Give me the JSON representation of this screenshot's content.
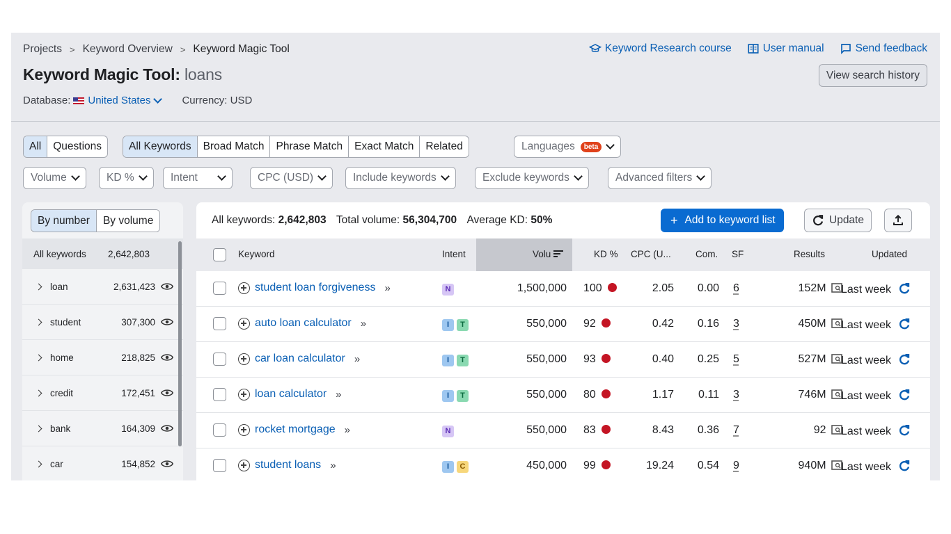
{
  "breadcrumbs": [
    "Projects",
    "Keyword Overview",
    "Keyword Magic Tool"
  ],
  "top_links": {
    "course": "Keyword Research course",
    "manual": "User manual",
    "feedback": "Send feedback"
  },
  "title": {
    "tool": "Keyword Magic Tool:",
    "query": "loans"
  },
  "view_history": "View search history",
  "database": {
    "label": "Database:",
    "country": "United States",
    "currency": "Currency: USD"
  },
  "tabs_a": [
    "All",
    "Questions"
  ],
  "tabs_b": [
    "All Keywords",
    "Broad Match",
    "Phrase Match",
    "Exact Match",
    "Related"
  ],
  "languages": {
    "label": "Languages",
    "badge": "beta"
  },
  "filters": {
    "volume": "Volume",
    "kd": "KD %",
    "intent": "Intent",
    "cpc": "CPC (USD)",
    "include": "Include keywords",
    "exclude": "Exclude keywords",
    "advanced": "Advanced filters"
  },
  "left_panel": {
    "toggle": [
      "By number",
      "By volume"
    ],
    "all_label": "All keywords",
    "all_count": "2,642,803",
    "groups": [
      {
        "kw": "loan",
        "count": "2,631,423"
      },
      {
        "kw": "student",
        "count": "307,300"
      },
      {
        "kw": "home",
        "count": "218,825"
      },
      {
        "kw": "credit",
        "count": "172,451"
      },
      {
        "kw": "bank",
        "count": "164,309"
      },
      {
        "kw": "car",
        "count": "154,852"
      }
    ]
  },
  "summary": {
    "all_label": "All keywords:",
    "all_value": "2,642,803",
    "vol_label": "Total volume:",
    "vol_value": "56,304,700",
    "kd_label": "Average KD:",
    "kd_value": "50%"
  },
  "buttons": {
    "add": "Add to keyword list",
    "update": "Update"
  },
  "columns": [
    "Keyword",
    "Intent",
    "Volu",
    "KD %",
    "CPC (U...",
    "Com.",
    "SF",
    "Results",
    "Updated"
  ],
  "rows": [
    {
      "kw": "student loan forgiveness",
      "intent": [
        "N"
      ],
      "volume": "1,500,000",
      "kd": "100",
      "cpc": "2.05",
      "com": "0.00",
      "sf": "6",
      "results": "152M",
      "updated": "Last week"
    },
    {
      "kw": "auto loan calculator",
      "intent": [
        "I",
        "T"
      ],
      "volume": "550,000",
      "kd": "92",
      "cpc": "0.42",
      "com": "0.16",
      "sf": "3",
      "results": "450M",
      "updated": "Last week"
    },
    {
      "kw": "car loan calculator",
      "intent": [
        "I",
        "T"
      ],
      "volume": "550,000",
      "kd": "93",
      "cpc": "0.40",
      "com": "0.25",
      "sf": "5",
      "results": "527M",
      "updated": "Last week"
    },
    {
      "kw": "loan calculator",
      "intent": [
        "I",
        "T"
      ],
      "volume": "550,000",
      "kd": "80",
      "cpc": "1.17",
      "com": "0.11",
      "sf": "3",
      "results": "746M",
      "updated": "Last week"
    },
    {
      "kw": "rocket mortgage",
      "intent": [
        "N"
      ],
      "volume": "550,000",
      "kd": "83",
      "cpc": "8.43",
      "com": "0.36",
      "sf": "7",
      "results": "92",
      "updated": "Last week"
    },
    {
      "kw": "student loans",
      "intent": [
        "I",
        "C"
      ],
      "volume": "450,000",
      "kd": "99",
      "cpc": "19.24",
      "com": "0.54",
      "sf": "9",
      "results": "940M",
      "updated": "Last week"
    }
  ],
  "colors": {
    "link": "#0a5fb4",
    "primary_button": "#0a6bd1",
    "kd_dot": "#c41524"
  }
}
